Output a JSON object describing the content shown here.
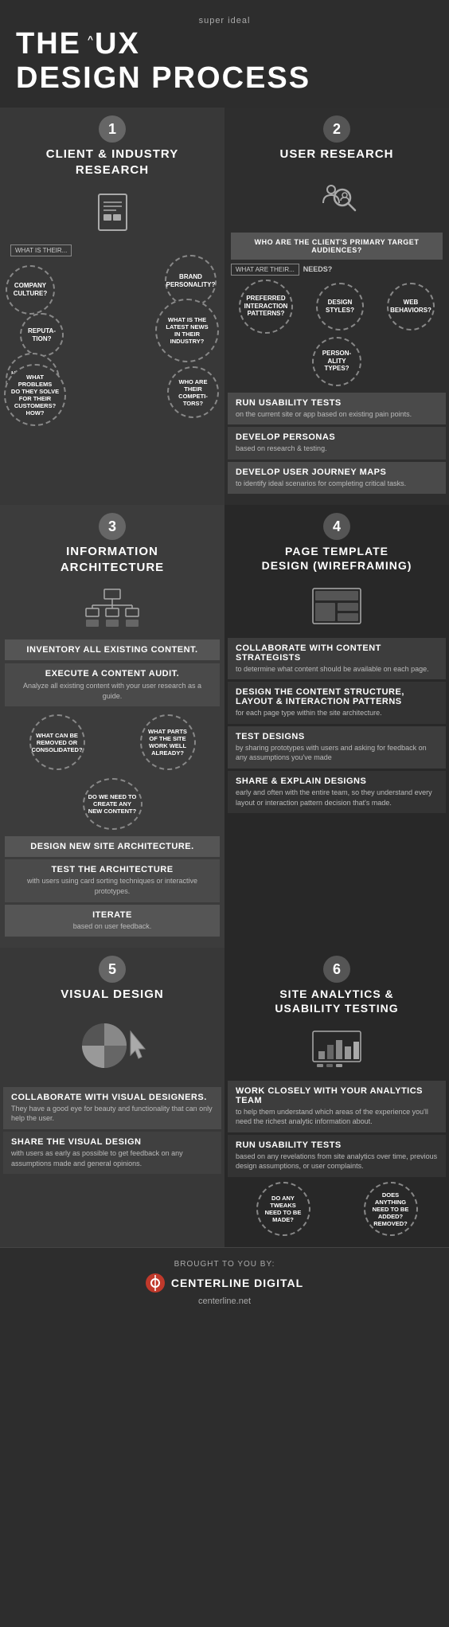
{
  "header": {
    "super_ideal": "super ideal",
    "the": "THE",
    "caret": "^",
    "ux": "UX",
    "design_process": "DESIGN PROCESS"
  },
  "section1": {
    "number": "1",
    "title": "CLIENT & INDUSTRY\nRESEARCH",
    "what_is_label": "WHAT IS THEIR...",
    "bubbles": [
      {
        "text": "COMPANY CULTURE?",
        "size": 58
      },
      {
        "text": "BRAND PERSONALITY?",
        "size": 60
      },
      {
        "text": "REPUTATION?",
        "size": 52
      },
      {
        "text": "WHAT IS THE LATEST NEWS IN THEIR INDUSTRY?",
        "size": 70
      },
      {
        "text": "HOW DO THEY RUN THEIR BUSINESS?",
        "size": 62
      },
      {
        "text": "WHAT PROBLEMS DO THEY SOLVE FOR THEIR CUSTOMERS? HOW?",
        "size": 68
      },
      {
        "text": "WHO ARE THEIR COMPETITORS?",
        "size": 58
      }
    ]
  },
  "section2": {
    "number": "2",
    "title": "USER RESEARCH",
    "query": "WHO ARE THE CLIENT'S PRIMARY TARGET AUDIENCES?",
    "what_are_label": "WHAT ARE THEIR...",
    "needs_label": "NEEDS?",
    "bubbles": [
      {
        "text": "PREFERRED INTERACTION PATTERNS?"
      },
      {
        "text": "DESIGN STYLES?"
      },
      {
        "text": "WEB BEHAVIORS?"
      },
      {
        "text": "PERSONALITY TYPES?"
      }
    ],
    "info_blocks": [
      {
        "title": "RUN USABILITY TESTS",
        "desc": "on the current site or app based on existing pain points."
      },
      {
        "title": "DEVELOP PERSONAS",
        "desc": "based on research & testing."
      },
      {
        "title": "DEVELOP USER JOURNEY MAPS",
        "desc": "to identify ideal scenarios for completing critical tasks."
      }
    ]
  },
  "section3": {
    "number": "3",
    "title": "INFORMATION ARCHITECTURE",
    "blocks": [
      {
        "title": "INVENTORY ALL EXISTING CONTENT.",
        "desc": ""
      },
      {
        "title": "EXECUTE A CONTENT AUDIT.",
        "desc": "Analyze all existing content with your user research as a guide."
      }
    ],
    "questions": [
      {
        "text": "WHAT CAN BE REMOVED OR CONSOLIDATED?"
      },
      {
        "text": "WHAT PARTS OF THE SITE WORK WELL ALREADY?"
      }
    ],
    "center_q": "DO WE NEED TO CREATE ANY NEW CONTENT?",
    "bottom_blocks": [
      {
        "title": "DESIGN NEW SITE ARCHITECTURE.",
        "desc": ""
      },
      {
        "title": "TEST THE ARCHITECTURE",
        "desc": "with users using card sorting techniques or interactive prototypes."
      },
      {
        "title": "ITERATE",
        "desc": "based on user feedback."
      }
    ]
  },
  "section4": {
    "number": "4",
    "title": "PAGE TEMPLATE DESIGN (WIREFRAMING)",
    "blocks": [
      {
        "title": "COLLABORATE WITH CONTENT STRATEGISTS",
        "desc": "to determine what content should be available on each page."
      },
      {
        "title": "DESIGN THE CONTENT STRUCTURE, LAYOUT & INTERACTION PATTERNS",
        "desc": "for each page type within the site architecture."
      },
      {
        "title": "TEST DESIGNS",
        "desc": "by sharing prototypes with users and asking for feedback on any assumptions you've made"
      },
      {
        "title": "SHARE & EXPLAIN DESIGNS",
        "desc": "early and often with the entire team, so they understand every layout or interaction pattern decision that's made."
      }
    ]
  },
  "section5": {
    "number": "5",
    "title": "VISUAL DESIGN",
    "blocks": [
      {
        "title": "COLLABORATE WITH VISUAL DESIGNERS.",
        "desc": "They have a good eye for beauty and functionality that can only help the user."
      },
      {
        "title": "SHARE THE VISUAL DESIGN",
        "desc": "with users as early as possible to get feedback on any assumptions made and general opinions."
      }
    ]
  },
  "section6": {
    "number": "6",
    "title": "SITE ANALYTICS & USABILITY TESTING",
    "blocks": [
      {
        "title": "WORK CLOSELY WITH YOUR ANALYTICS TEAM",
        "desc": "to help them understand which areas of the experience you'll need the richest analytic information about."
      },
      {
        "title": "RUN USABILITY TESTS",
        "desc": "based on any revelations from site analytics over time, previous design assumptions, or user complaints."
      }
    ],
    "questions": [
      {
        "text": "DO ANY TWEAKS NEED TO BE MADE?"
      },
      {
        "text": "DOES ANYTHING NEED TO BE ADDED? REMOVED?"
      }
    ]
  },
  "footer": {
    "brought": "BROUGHT TO YOU BY:",
    "brand": "CENTERLINE DIGITAL",
    "url": "centerline.net"
  }
}
